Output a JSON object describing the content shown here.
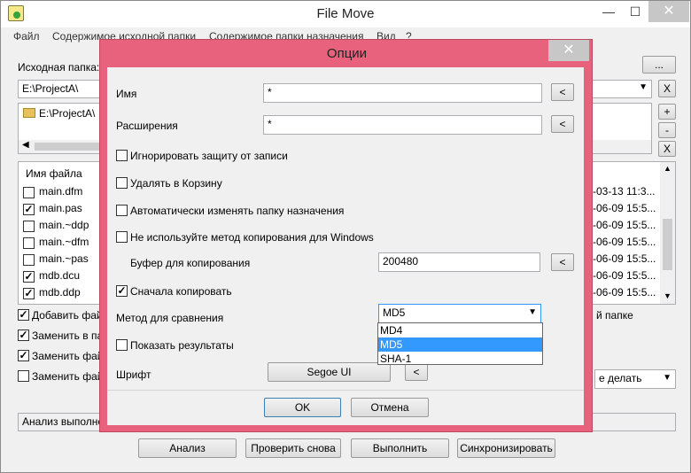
{
  "window": {
    "title": "File Move",
    "close": "✕",
    "minimize": "—",
    "maximize": "☐"
  },
  "menu": [
    "Файл",
    "Содержимое исходной папки",
    "Содержимое папки назначения",
    "Вид",
    "?"
  ],
  "source": {
    "label": "Исходная папка:",
    "browse_btn": "...",
    "path": "E:\\ProjectA\\",
    "tree_item": "E:\\ProjectA\\",
    "clear_btn": "X",
    "plus_btn": "+",
    "minus_btn": "-",
    "x_btn": "X"
  },
  "files": {
    "header": "Имя файла",
    "rows": [
      {
        "name": "main.dfm",
        "checked": false,
        "date": "-03-13 11:3..."
      },
      {
        "name": "main.pas",
        "checked": true,
        "date": "-06-09 15:5..."
      },
      {
        "name": "main.~ddp",
        "checked": false,
        "date": "-06-09 15:5..."
      },
      {
        "name": "main.~dfm",
        "checked": false,
        "date": "-06-09 15:5..."
      },
      {
        "name": "main.~pas",
        "checked": false,
        "date": "-06-09 15:5..."
      },
      {
        "name": "mdb.dcu",
        "checked": true,
        "date": "-06-09 15:5..."
      },
      {
        "name": "mdb.ddp",
        "checked": true,
        "date": "-06-09 15:5..."
      }
    ]
  },
  "options_main": [
    {
      "label": "Добавить фай",
      "checked": true
    },
    {
      "label": "Заменить в па",
      "checked": true
    },
    {
      "label": "Заменить фай",
      "checked": true
    },
    {
      "label": "Заменить фай",
      "checked": false
    }
  ],
  "right_text": "й папке",
  "action_select": "е делать",
  "status": "Анализ выполне",
  "bottom_buttons": [
    "Анализ",
    "Проверить снова",
    "Выполнить",
    "Синхронизировать"
  ],
  "dialog": {
    "title": "Опции",
    "close": "✕",
    "name_label": "Имя",
    "name_value": "*",
    "ext_label": "Расширения",
    "ext_value": "*",
    "back_btn": "<",
    "checkboxes": [
      {
        "label": "Игнорировать защиту от записи",
        "checked": false
      },
      {
        "label": "Удалять в Корзину",
        "checked": false
      },
      {
        "label": "Автоматически изменять папку назначения",
        "checked": false
      },
      {
        "label": "Не используйте метод копирования для Windows",
        "checked": false
      }
    ],
    "buffer_label": "Буфер для копирования",
    "buffer_value": "200480",
    "copy_first": {
      "label": "Сначала копировать",
      "checked": true
    },
    "compare_label": "Метод для сравнения",
    "compare_value": "MD5",
    "compare_options": [
      "MD4",
      "MD5",
      "SHA-1"
    ],
    "compare_selected_index": 1,
    "show_results": {
      "label": "Показать результаты",
      "checked": false
    },
    "font_label": "Шрифт",
    "font_value": "Segoe UI",
    "ok": "OK",
    "cancel": "Отмена"
  }
}
